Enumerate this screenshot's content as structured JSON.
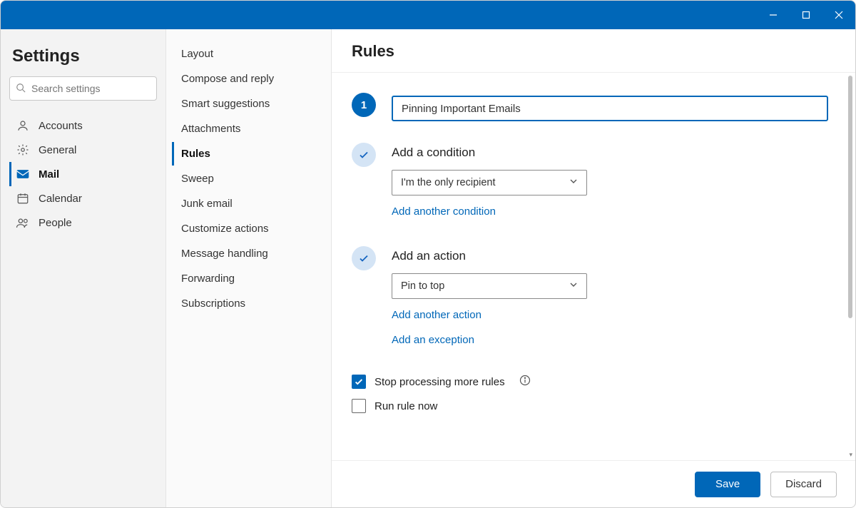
{
  "titlebar": {},
  "sidebar": {
    "title": "Settings",
    "search_placeholder": "Search settings",
    "categories": [
      {
        "label": "Accounts",
        "icon": "person"
      },
      {
        "label": "General",
        "icon": "gear"
      },
      {
        "label": "Mail",
        "icon": "mail",
        "active": true
      },
      {
        "label": "Calendar",
        "icon": "calendar"
      },
      {
        "label": "People",
        "icon": "people"
      }
    ]
  },
  "subnav": {
    "items": [
      {
        "label": "Layout"
      },
      {
        "label": "Compose and reply"
      },
      {
        "label": "Smart suggestions"
      },
      {
        "label": "Attachments"
      },
      {
        "label": "Rules",
        "active": true
      },
      {
        "label": "Sweep"
      },
      {
        "label": "Junk email"
      },
      {
        "label": "Customize actions"
      },
      {
        "label": "Message handling"
      },
      {
        "label": "Forwarding"
      },
      {
        "label": "Subscriptions"
      }
    ]
  },
  "main": {
    "title": "Rules",
    "step_number": "1",
    "rule_name_value": "Pinning Important Emails",
    "condition": {
      "heading": "Add a condition",
      "selected": "I'm the only recipient",
      "add_another": "Add another condition"
    },
    "action": {
      "heading": "Add an action",
      "selected": "Pin to top",
      "add_another": "Add another action"
    },
    "exception": {
      "add": "Add an exception"
    },
    "stop_processing": {
      "label": "Stop processing more rules",
      "checked": true
    },
    "run_now": {
      "label": "Run rule now",
      "checked": false
    }
  },
  "footer": {
    "save": "Save",
    "discard": "Discard"
  }
}
